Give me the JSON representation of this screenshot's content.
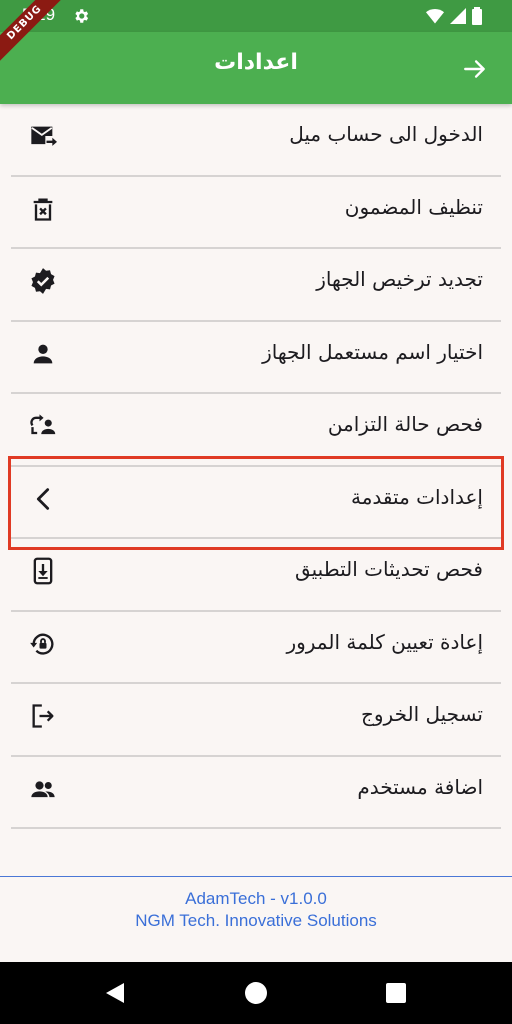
{
  "status_bar": {
    "time": "5:29",
    "debug_label": "DEBUG"
  },
  "app_bar": {
    "title": "اعدادات"
  },
  "menu": {
    "items": [
      {
        "label": "الدخول الى حساب ميل",
        "icon": "mail-forward-icon"
      },
      {
        "label": "تنظيف المضمون",
        "icon": "delete-forever-icon"
      },
      {
        "label": "تجديد ترخيص الجهاز",
        "icon": "verified-badge-icon"
      },
      {
        "label": "اختيار اسم مستعمل الجهاز",
        "icon": "person-icon"
      },
      {
        "label": "فحص حالة التزامن",
        "icon": "sync-person-icon"
      },
      {
        "label": "إعدادات متقدمة",
        "icon": "chevron-left-icon"
      },
      {
        "label": "فحص تحديثات التطبيق",
        "icon": "phone-download-icon"
      },
      {
        "label": "إعادة تعيين كلمة المرور",
        "icon": "lock-reset-icon"
      },
      {
        "label": "تسجيل الخروج",
        "icon": "logout-icon"
      },
      {
        "label": "اضافة مستخدم",
        "icon": "group-icon"
      }
    ]
  },
  "footer": {
    "version": "AdamTech - v1.0.0",
    "company": "NGM Tech. Innovative Solutions"
  },
  "colors": {
    "app_bar": "#4caf50",
    "status_bar": "#3f9a43",
    "background": "#faf6f4",
    "highlight": "#e03a24",
    "footer_text": "#3a6fd8"
  }
}
